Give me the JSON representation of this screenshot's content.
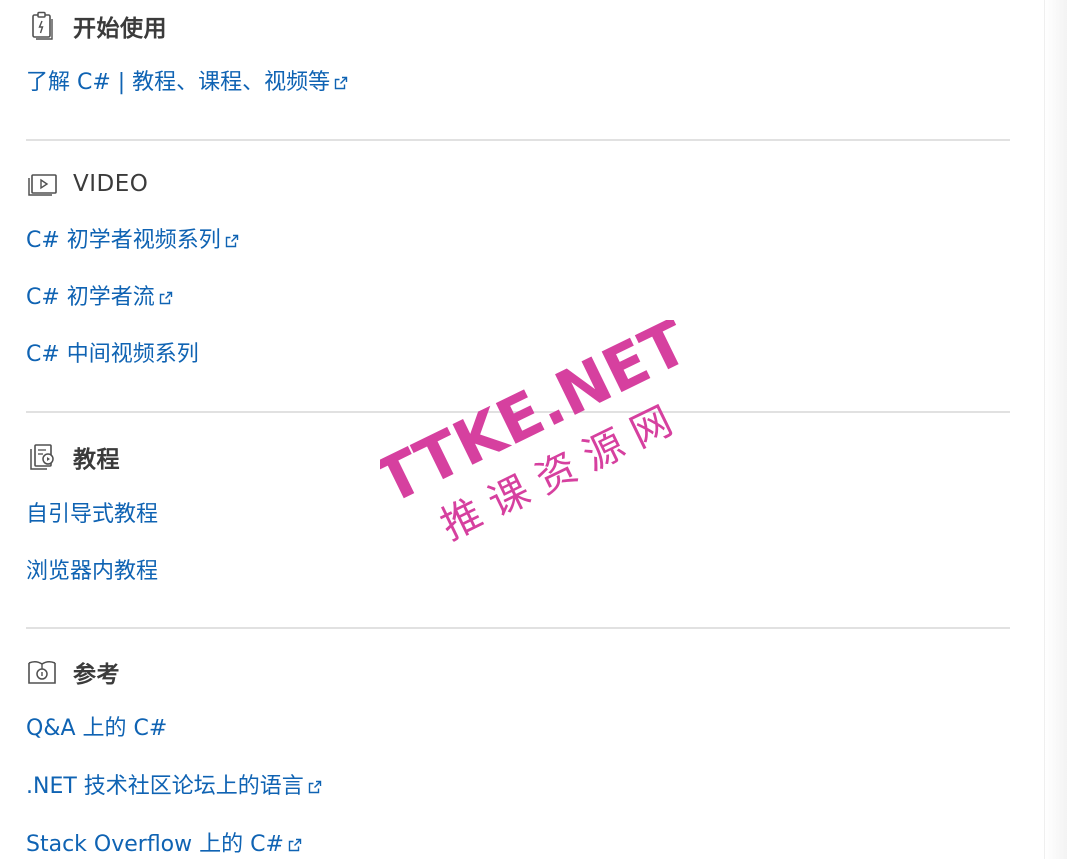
{
  "sections": [
    {
      "title": "开始使用",
      "icon": "clipboard-icon",
      "links": [
        {
          "label": "了解 C# | 教程、课程、视频等",
          "external": true
        }
      ]
    },
    {
      "title": "VIDEO",
      "icon": "video-icon",
      "links": [
        {
          "label": "C# 初学者视频系列",
          "external": true
        },
        {
          "label": "C# 初学者流",
          "external": true
        },
        {
          "label": "C# 中间视频系列",
          "external": false
        }
      ]
    },
    {
      "title": "教程",
      "icon": "tutorial-icon",
      "links": [
        {
          "label": "自引导式教程",
          "external": false
        },
        {
          "label": "浏览器内教程",
          "external": false
        }
      ]
    },
    {
      "title": "参考",
      "icon": "reference-book-icon",
      "links": [
        {
          "label": "Q&A 上的 C#",
          "external": false
        },
        {
          "label": ".NET 技术社区论坛上的语言",
          "external": true
        },
        {
          "label": "Stack Overflow 上的 C#",
          "external": true
        }
      ]
    }
  ],
  "watermark": {
    "line1": "TTKE.NET",
    "line2": "推 课 资 源 网"
  },
  "colors": {
    "link": "#0f63b3",
    "heading": "#3b3b3b",
    "divider": "#e1e1e1",
    "watermark": "#d6409f"
  }
}
